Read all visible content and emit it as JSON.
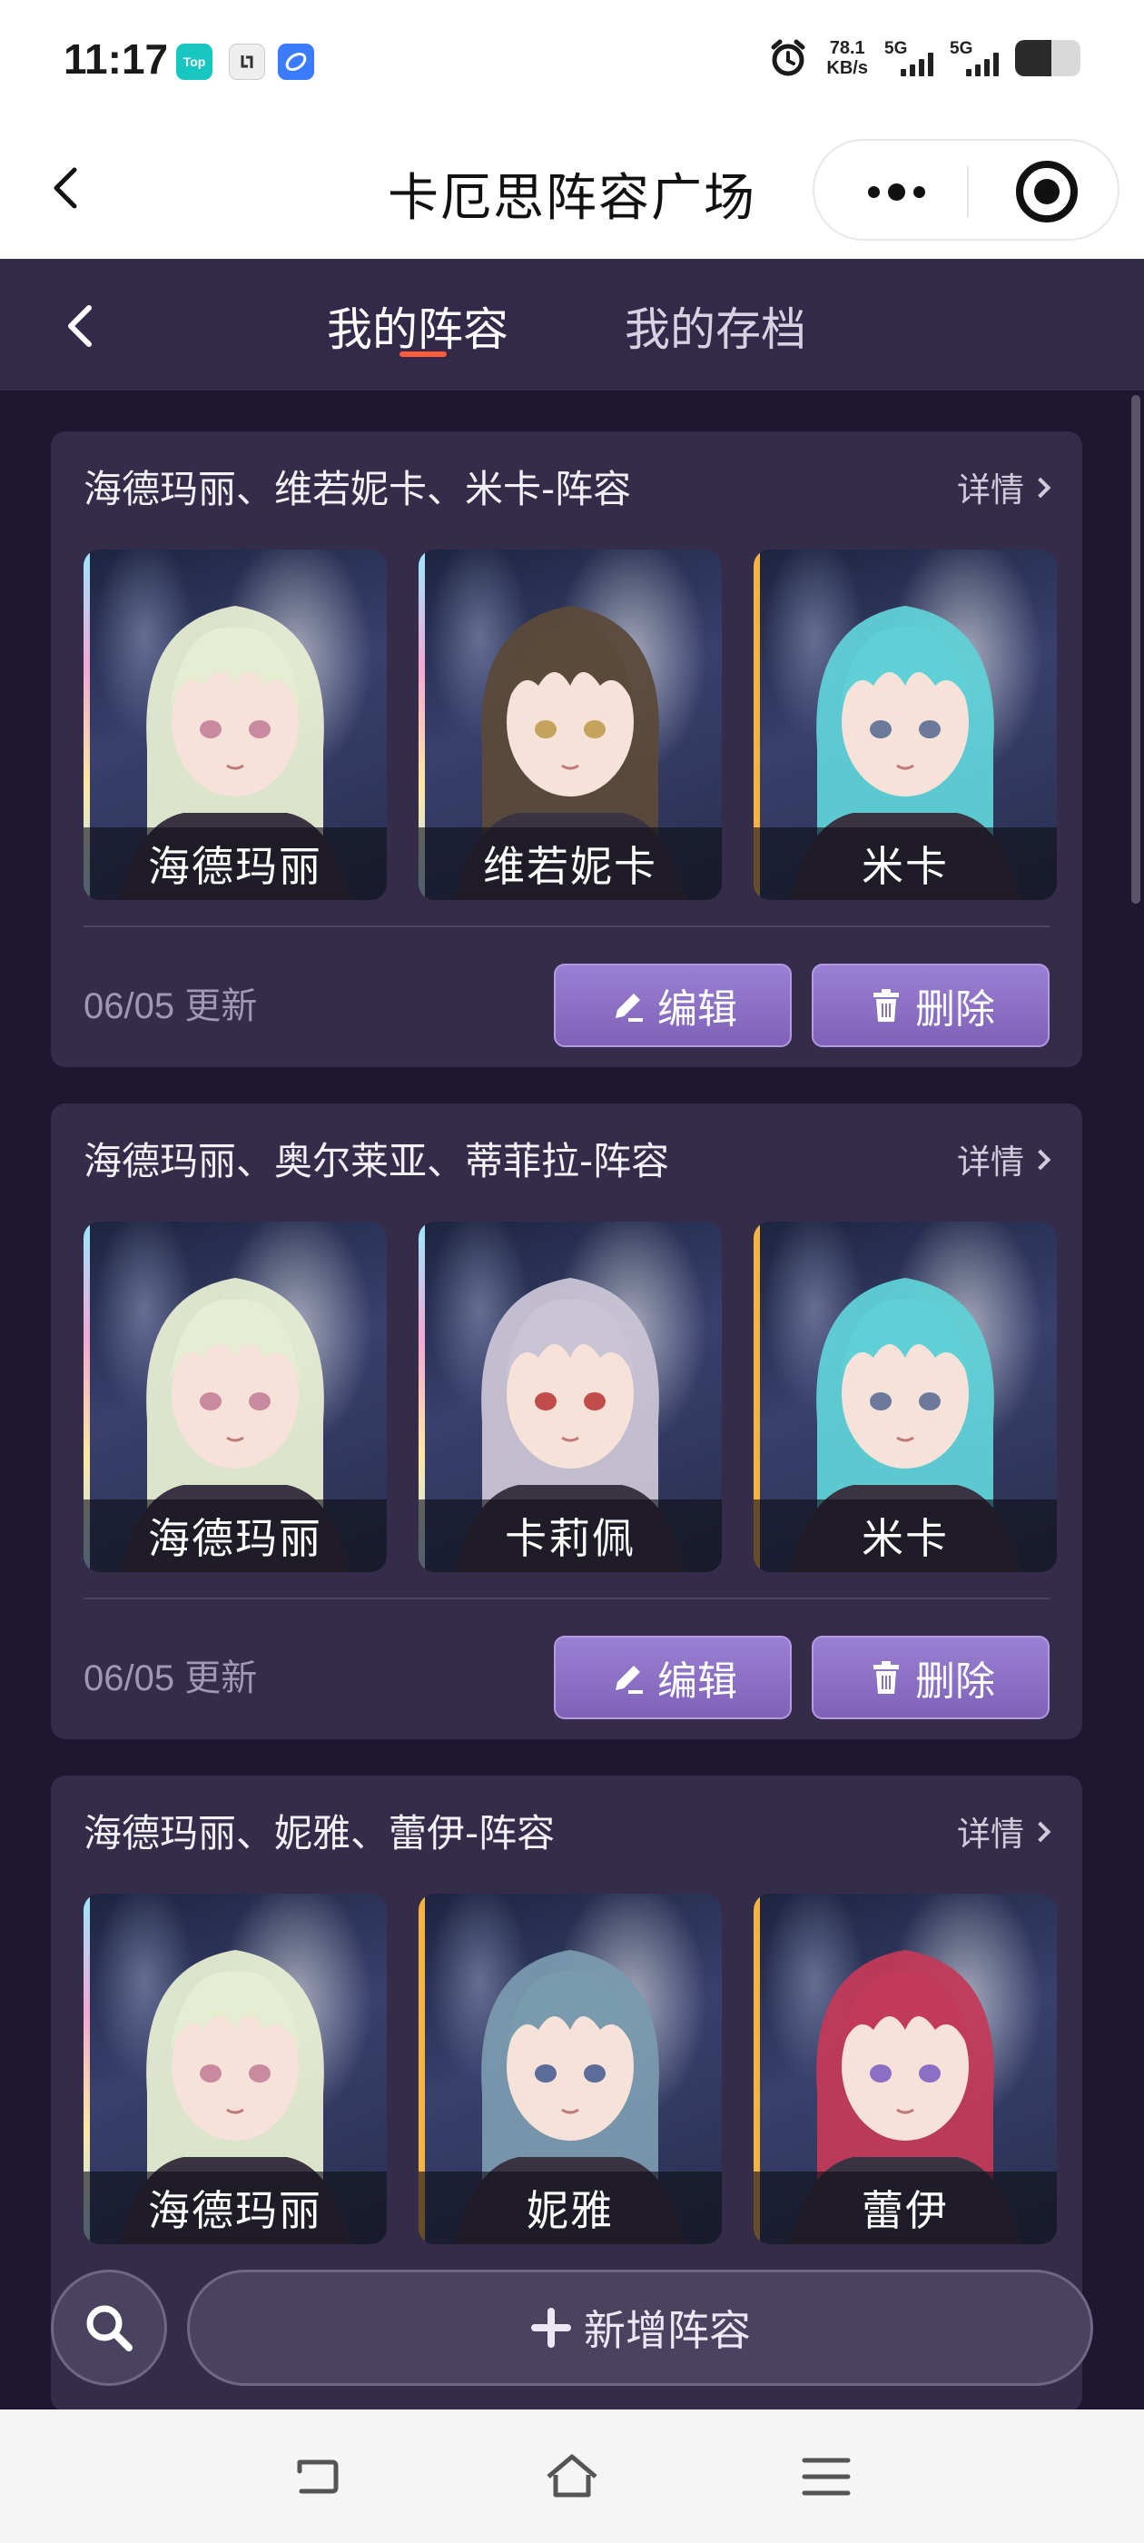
{
  "status_bar": {
    "time": "11:17",
    "apps": [
      {
        "icon": "top-app-icon",
        "label": "Top",
        "color": "#19c7c2"
      },
      {
        "icon": "link-app-icon",
        "label": "",
        "color": "#eeeeee"
      },
      {
        "icon": "browser-app-icon",
        "label": "",
        "color": "#3b7cff"
      }
    ],
    "net_speed_value": "78.1",
    "net_speed_unit": "KB/s",
    "signal_1_label": "5G",
    "signal_2_label": "5G",
    "battery_level": 0.55
  },
  "title_bar": {
    "title": "卡厄思阵容广场"
  },
  "nav": {
    "tabs": [
      {
        "label": "我的阵容",
        "active": true
      },
      {
        "label": "我的存档",
        "active": false
      }
    ]
  },
  "teams": [
    {
      "title": "海德玛丽、维若妮卡、米卡-阵容",
      "detail_label": "详情",
      "date": "06/05 更新",
      "members": [
        {
          "name": "海德玛丽",
          "rarity": "prism",
          "hair": "#e6edd2",
          "eye": "#c98aa0"
        },
        {
          "name": "维若妮卡",
          "rarity": "prism",
          "hair": "#5b4a3a",
          "eye": "#c4a35a"
        },
        {
          "name": "米卡",
          "rarity": "gold",
          "hair": "#5fd1d6",
          "eye": "#6b7a9a"
        }
      ],
      "edit_label": "编辑",
      "delete_label": "删除"
    },
    {
      "title": "海德玛丽、奥尔莱亚、蒂菲拉-阵容",
      "detail_label": "详情",
      "date": "06/05 更新",
      "members": [
        {
          "name": "海德玛丽",
          "rarity": "prism",
          "hair": "#e6edd2",
          "eye": "#c98aa0"
        },
        {
          "name": "卡莉佩",
          "rarity": "prism",
          "hair": "#c9c4d4",
          "eye": "#c24b4b"
        },
        {
          "name": "米卡",
          "rarity": "gold",
          "hair": "#5fd1d6",
          "eye": "#6b7a9a"
        }
      ],
      "edit_label": "编辑",
      "delete_label": "删除"
    },
    {
      "title": "海德玛丽、妮雅、蕾伊-阵容",
      "detail_label": "详情",
      "date": "",
      "members": [
        {
          "name": "海德玛丽",
          "rarity": "prism",
          "hair": "#e6edd2",
          "eye": "#c98aa0"
        },
        {
          "name": "妮雅",
          "rarity": "gold",
          "hair": "#7a9aae",
          "eye": "#5a6c9a"
        },
        {
          "name": "蕾伊",
          "rarity": "gold",
          "hair": "#c23a5a",
          "eye": "#8a6fc4"
        }
      ],
      "edit_label": "",
      "delete_label": ""
    }
  ],
  "bottom": {
    "add_label": "新增阵容"
  },
  "colors": {
    "app_bg": "#1f1731",
    "card_bg": "#342c49",
    "accent": "#8f74c8",
    "tab_indicator": "#ff5a3c"
  }
}
